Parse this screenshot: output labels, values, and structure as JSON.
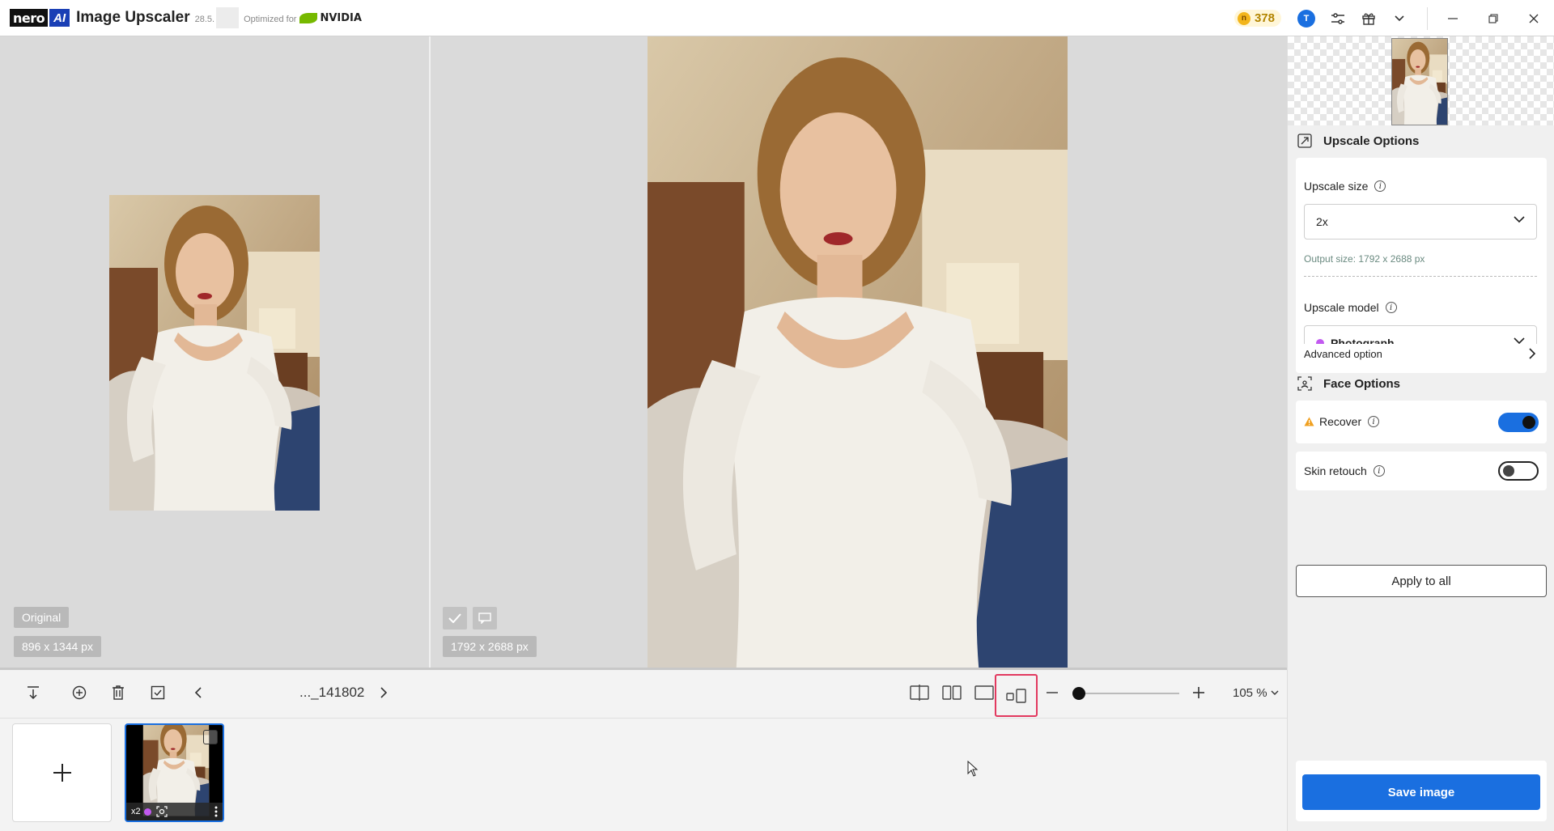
{
  "app": {
    "brand": "nero",
    "ai_badge": "AI",
    "title": "Image Upscaler",
    "version": "28.5.",
    "optimized_for": "Optimized for",
    "nvidia": "NVIDIA"
  },
  "titlebar": {
    "credits": "378",
    "avatar_initial": "T"
  },
  "compare": {
    "original_label": "Original",
    "original_size": "896 x 1344 px",
    "result_size": "1792 x 2688 px"
  },
  "toolbar": {
    "filename": "..._141802",
    "zoom": "105 %"
  },
  "thumbnail": {
    "scale_badge": "x2"
  },
  "panel": {
    "upscale_options_title": "Upscale Options",
    "upscale_size_label": "Upscale size",
    "upscale_size_value": "2x",
    "output_size": "Output size: 1792 x 2688 px",
    "upscale_model_label": "Upscale model",
    "upscale_model_value": "Photograph",
    "advanced_option": "Advanced option",
    "face_options_title": "Face Options",
    "recover_label": "Recover",
    "recover_on": true,
    "skin_retouch_label": "Skin retouch",
    "skin_retouch_on": false,
    "apply_to_all": "Apply to all",
    "save_image": "Save image"
  },
  "colors": {
    "accent": "#1a6fe0",
    "highlight_border": "#e2395f",
    "model_dot": "#c259f0",
    "warning": "#f0a020"
  }
}
